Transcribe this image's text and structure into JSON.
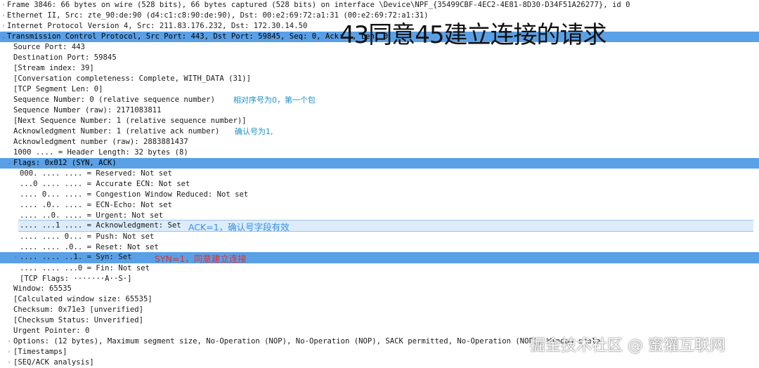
{
  "overlay_title": "43同意45建立连接的请求",
  "watermark": "掘金技术社区 @ 蜜獾互联网",
  "rows": [
    "Frame 3846: 66 bytes on wire (528 bits), 66 bytes captured (528 bits) on interface \\Device\\NPF_{35499CBF-4EC2-4E81-8D30-D34F51A26277}, id 0",
    "Ethernet II, Src: zte_90:de:90 (d4:c1:c8:90:de:90), Dst: 00:e2:69:72:a1:31 (00:e2:69:72:a1:31)",
    "Internet Protocol Version 4, Src: 211.83.176.232, Dst: 172.30.14.50",
    "Transmission Control Protocol, Src Port: 443, Dst Port: 59845, Seq: 0, Ack: 1, Len: 0",
    "Source Port: 443",
    "Destination Port: 59845",
    "[Stream index: 39]",
    "[Conversation completeness: Complete, WITH_DATA (31)]",
    "[TCP Segment Len: 0]",
    "Sequence Number: 0    (relative sequence number)",
    "Sequence Number (raw): 2171083811",
    "[Next Sequence Number: 1    (relative sequence number)]",
    "Acknowledgment Number: 1    (relative ack number)",
    "Acknowledgment number (raw): 2883881437",
    "1000 .... = Header Length: 32 bytes (8)",
    "Flags: 0x012 (SYN, ACK)",
    "000. .... .... = Reserved: Not set",
    "...0 .... .... = Accurate ECN: Not set",
    ".... 0... .... = Congestion Window Reduced: Not set",
    ".... .0.. .... = ECN-Echo: Not set",
    ".... ..0. .... = Urgent: Not set",
    ".... ...1 .... = Acknowledgment: Set",
    ".... .... 0... = Push: Not set",
    ".... .... .0.. = Reset: Not set",
    ".... .... ..1. = Syn: Set",
    ".... .... ...0 = Fin: Not set",
    "[TCP Flags: ·······A··S·]",
    "Window: 65535",
    "[Calculated window size: 65535]",
    "Checksum: 0x71e3 [unverified]",
    "[Checksum Status: Unverified]",
    "Urgent Pointer: 0",
    "Options: (12 bytes), Maximum segment size, No-Operation (NOP), No-Operation (NOP), SACK permitted, No-Operation (NOP), Window scale",
    "[Timestamps]",
    "[SEQ/ACK analysis]"
  ],
  "annotations": {
    "seq": "相对序号为0，第一个包",
    "ack": "确认号为1,",
    "ack_flag": "ACK=1，确认号字段有效",
    "syn_flag": "SYN=1，同意建立连接"
  }
}
